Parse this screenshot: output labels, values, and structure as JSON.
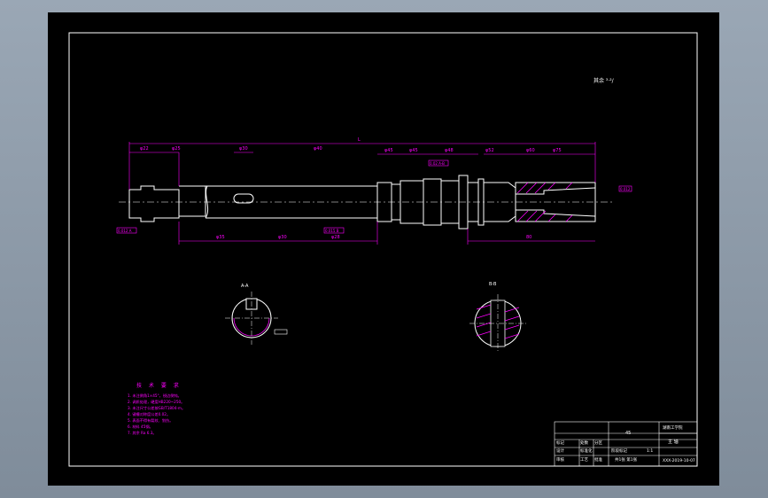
{
  "drawing": {
    "roughness_note": "其余 ³·²/",
    "overall_length": "L",
    "dims_top": [
      "φ22",
      "φ25",
      "φ30",
      "φ40",
      "φ45",
      "φ45",
      "φ48",
      "φ52",
      "φ60",
      "φ75"
    ],
    "dims_bottom": [
      "φ35",
      "φ30",
      "φ28",
      "80"
    ],
    "section_a_label": "A-A",
    "section_b_label": "B-B",
    "tol_boxes": [
      "0.012 A",
      "0.015 B",
      "0.02 A-B",
      "0.012"
    ],
    "notes_title": "技 术 要 求",
    "notes": [
      "1. 未注倒角1×45°，锐边倒钝。",
      "2. 调质处理，硬度HB220~250。",
      "3. 未注尺寸公差按GB/T1804-m。",
      "4. 键槽对称度公差0.02。",
      "5. 表面不得有裂纹、划伤。",
      "6. 材料 45钢。",
      "7. 其余 Ra 6.3。"
    ]
  },
  "title_block": {
    "school": "湖南工学院",
    "drawing_title": "主 轴",
    "drawing_no": "XXX-2019-10-07",
    "scale": "1:1",
    "sheet": "共1张  第1张",
    "material": "45",
    "rows": [
      "标记",
      "处数",
      "分区",
      "更改文件号",
      "签名",
      "年月日"
    ],
    "row2": [
      "设计",
      "标准化",
      "阶段标记",
      "重量",
      "比例"
    ],
    "row3": [
      "审核",
      "工艺",
      "批准"
    ]
  }
}
